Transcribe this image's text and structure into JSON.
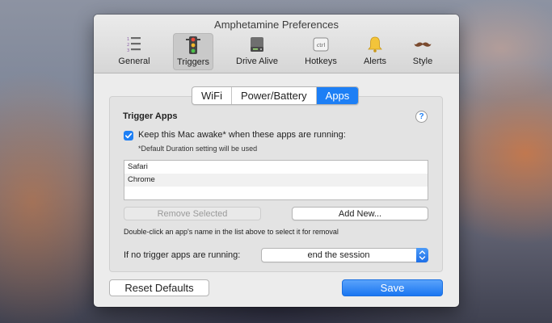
{
  "window": {
    "title": "Amphetamine Preferences"
  },
  "toolbar": {
    "items": [
      {
        "label": "General",
        "icon": "list-icon"
      },
      {
        "label": "Triggers",
        "icon": "traffic-light-icon",
        "selected": true
      },
      {
        "label": "Drive Alive",
        "icon": "hard-drive-icon"
      },
      {
        "label": "Hotkeys",
        "icon": "ctrl-key-icon"
      },
      {
        "label": "Alerts",
        "icon": "bell-icon"
      },
      {
        "label": "Style",
        "icon": "mustache-icon"
      }
    ],
    "ctrl_key_text": "ctrl"
  },
  "tabs": {
    "items": [
      "WiFi",
      "Power/Battery",
      "Apps"
    ],
    "selected": "Apps"
  },
  "trigger_apps": {
    "title": "Trigger Apps",
    "help": "?",
    "checkbox_checked": true,
    "checkbox_label": "Keep this Mac awake* when these apps are running:",
    "note": "*Default Duration setting will be used",
    "apps": [
      "Safari",
      "Chrome"
    ],
    "remove_label": "Remove Selected",
    "add_label": "Add New...",
    "hint": "Double-click an app's name in the list above to select it for removal",
    "fallback_label": "If no trigger apps are running:",
    "fallback_value": "end the session"
  },
  "footer": {
    "reset_label": "Reset Defaults",
    "save_label": "Save"
  },
  "colors": {
    "accent": "#1d7ff5"
  }
}
